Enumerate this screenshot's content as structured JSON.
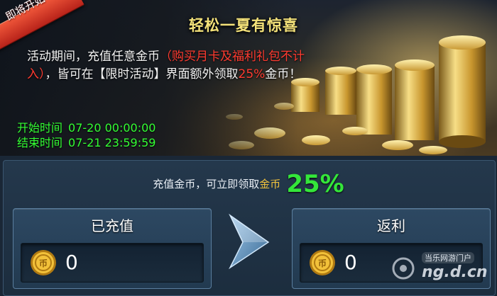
{
  "banner": {
    "ribbon_label": "即将开始",
    "title": "轻松一夏有惊喜",
    "desc_part1": "活动期间，充值任意金币",
    "desc_red": "（购买月卡及福利礼包不计入）",
    "desc_part2": "，皆可在【限时活动】界面额外领取",
    "desc_pct": "25%",
    "desc_part3": "金币！",
    "start_label": "开始时间",
    "start_value": "07-20 00:00:00",
    "end_label": "结束时间",
    "end_value": "07-21 23:59:59"
  },
  "rate": {
    "text_before": "充值金币，可立即领取",
    "text_gold": "金币",
    "percent": "25%"
  },
  "recharged": {
    "label": "已充值",
    "value": "0",
    "icon": "gold-coin-icon"
  },
  "rebate": {
    "label": "返利",
    "value": "0",
    "icon": "gold-coin-icon"
  },
  "watermark": {
    "small": "当乐网游门户",
    "big": "ng.d.cn"
  },
  "colors": {
    "title_gold": "#f4e27a",
    "red_note": "#ff3b30",
    "time_green": "#33ff33",
    "percent_green": "#34e63a",
    "coin_gold": "#f0c23c",
    "ribbon_red": "#d8321f"
  }
}
